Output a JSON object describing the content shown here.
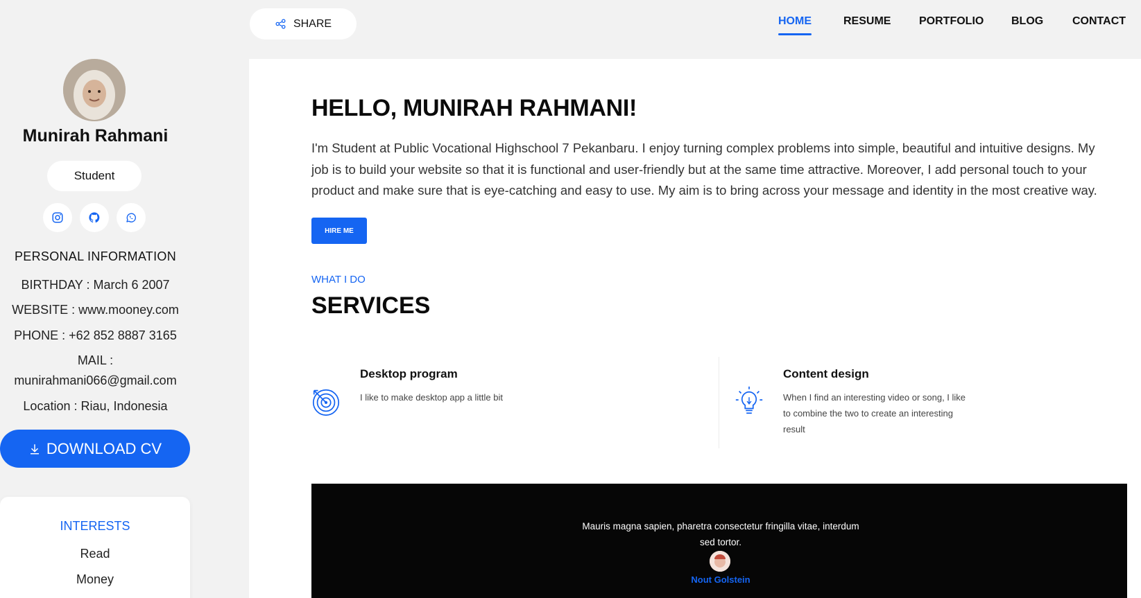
{
  "header": {
    "share_label": "SHARE",
    "nav": [
      {
        "label": "HOME",
        "active": true
      },
      {
        "label": "RESUME"
      },
      {
        "label": "PORTFOLIO"
      },
      {
        "label": "BLOG"
      },
      {
        "label": "CONTACT"
      }
    ]
  },
  "sidebar": {
    "name": "Munirah Rahmani",
    "role": "Student",
    "socials": [
      "instagram-icon",
      "github-icon",
      "whatsapp-icon"
    ],
    "personal_title": "PERSONAL INFORMATION",
    "birthday": "BIRTHDAY : March 6 2007",
    "website": "WEBSITE : www.mooney.com",
    "phone": "PHONE : +62 852 8887 3165",
    "mail_label": "MAIL :",
    "mail_value": "munirahmani066@gmail.com",
    "location": "Location : Riau, Indonesia",
    "download_label": "DOWNLOAD CV",
    "interests_title": "INTERESTS",
    "interests": [
      "Read",
      "Money"
    ]
  },
  "main": {
    "greeting": "HELLO, MUNIRAH RAHMANI!",
    "intro": "I'm Student at Public Vocational Highschool 7 Pekanbaru. I enjoy turning complex problems into simple, beautiful and intuitive designs. My job is to build your website so that it is functional and user-friendly but at the same time attractive. Moreover, I add personal touch to your product and make sure that is eye-catching and easy to use. My aim is to bring across your message and identity in the most creative way.",
    "hire_label": "HIRE ME",
    "what_i_do": "WHAT I DO",
    "services_title": "SERVICES",
    "services": [
      {
        "title": "Desktop program",
        "desc": "I like to make desktop app a little bit",
        "icon": "target-icon"
      },
      {
        "title": "Content design",
        "desc": "When I find an interesting video or song, I like to combine the two to create an interesting result",
        "icon": "lightbulb-icon"
      }
    ],
    "testimonial": {
      "quote": "Mauris magna sapien, pharetra consectetur fringilla vitae, interdum sed tortor.",
      "author": "Nout Golstein"
    }
  },
  "colors": {
    "accent": "#1565f2",
    "background": "#f2f2f2",
    "testimonial_bg": "#060606"
  }
}
